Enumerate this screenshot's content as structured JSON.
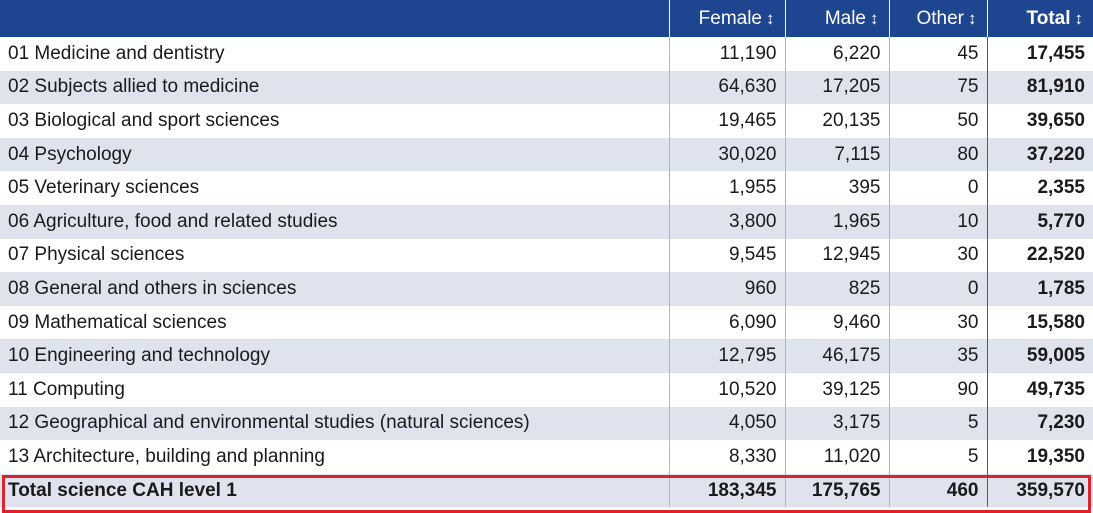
{
  "table": {
    "headers": {
      "subject": "",
      "female": "Female",
      "male": "Male",
      "other": "Other",
      "total": "Total",
      "sort_glyph": "↕"
    },
    "rows": [
      {
        "subject": "01 Medicine and dentistry",
        "female": "11,190",
        "male": "6,220",
        "other": "45",
        "total": "17,455"
      },
      {
        "subject": "02 Subjects allied to medicine",
        "female": "64,630",
        "male": "17,205",
        "other": "75",
        "total": "81,910"
      },
      {
        "subject": "03 Biological and sport sciences",
        "female": "19,465",
        "male": "20,135",
        "other": "50",
        "total": "39,650"
      },
      {
        "subject": "04 Psychology",
        "female": "30,020",
        "male": "7,115",
        "other": "80",
        "total": "37,220"
      },
      {
        "subject": "05 Veterinary sciences",
        "female": "1,955",
        "male": "395",
        "other": "0",
        "total": "2,355"
      },
      {
        "subject": "06 Agriculture, food and related studies",
        "female": "3,800",
        "male": "1,965",
        "other": "10",
        "total": "5,770"
      },
      {
        "subject": "07 Physical sciences",
        "female": "9,545",
        "male": "12,945",
        "other": "30",
        "total": "22,520"
      },
      {
        "subject": "08 General and others in sciences",
        "female": "960",
        "male": "825",
        "other": "0",
        "total": "1,785"
      },
      {
        "subject": "09 Mathematical sciences",
        "female": "6,090",
        "male": "9,460",
        "other": "30",
        "total": "15,580"
      },
      {
        "subject": "10 Engineering and technology",
        "female": "12,795",
        "male": "46,175",
        "other": "35",
        "total": "59,005"
      },
      {
        "subject": "11 Computing",
        "female": "10,520",
        "male": "39,125",
        "other": "90",
        "total": "49,735"
      },
      {
        "subject": "12 Geographical and environmental studies (natural sciences)",
        "female": "4,050",
        "male": "3,175",
        "other": "5",
        "total": "7,230"
      },
      {
        "subject": "13 Architecture, building and planning",
        "female": "8,330",
        "male": "11,020",
        "other": "5",
        "total": "19,350"
      }
    ],
    "summary": {
      "subject": "Total science CAH level 1",
      "female": "183,345",
      "male": "175,765",
      "other": "460",
      "total": "359,570"
    }
  },
  "colors": {
    "header_bg": "#1e4690",
    "stripe_bg": "#dfe3ed",
    "highlight_border": "#e0202a"
  }
}
